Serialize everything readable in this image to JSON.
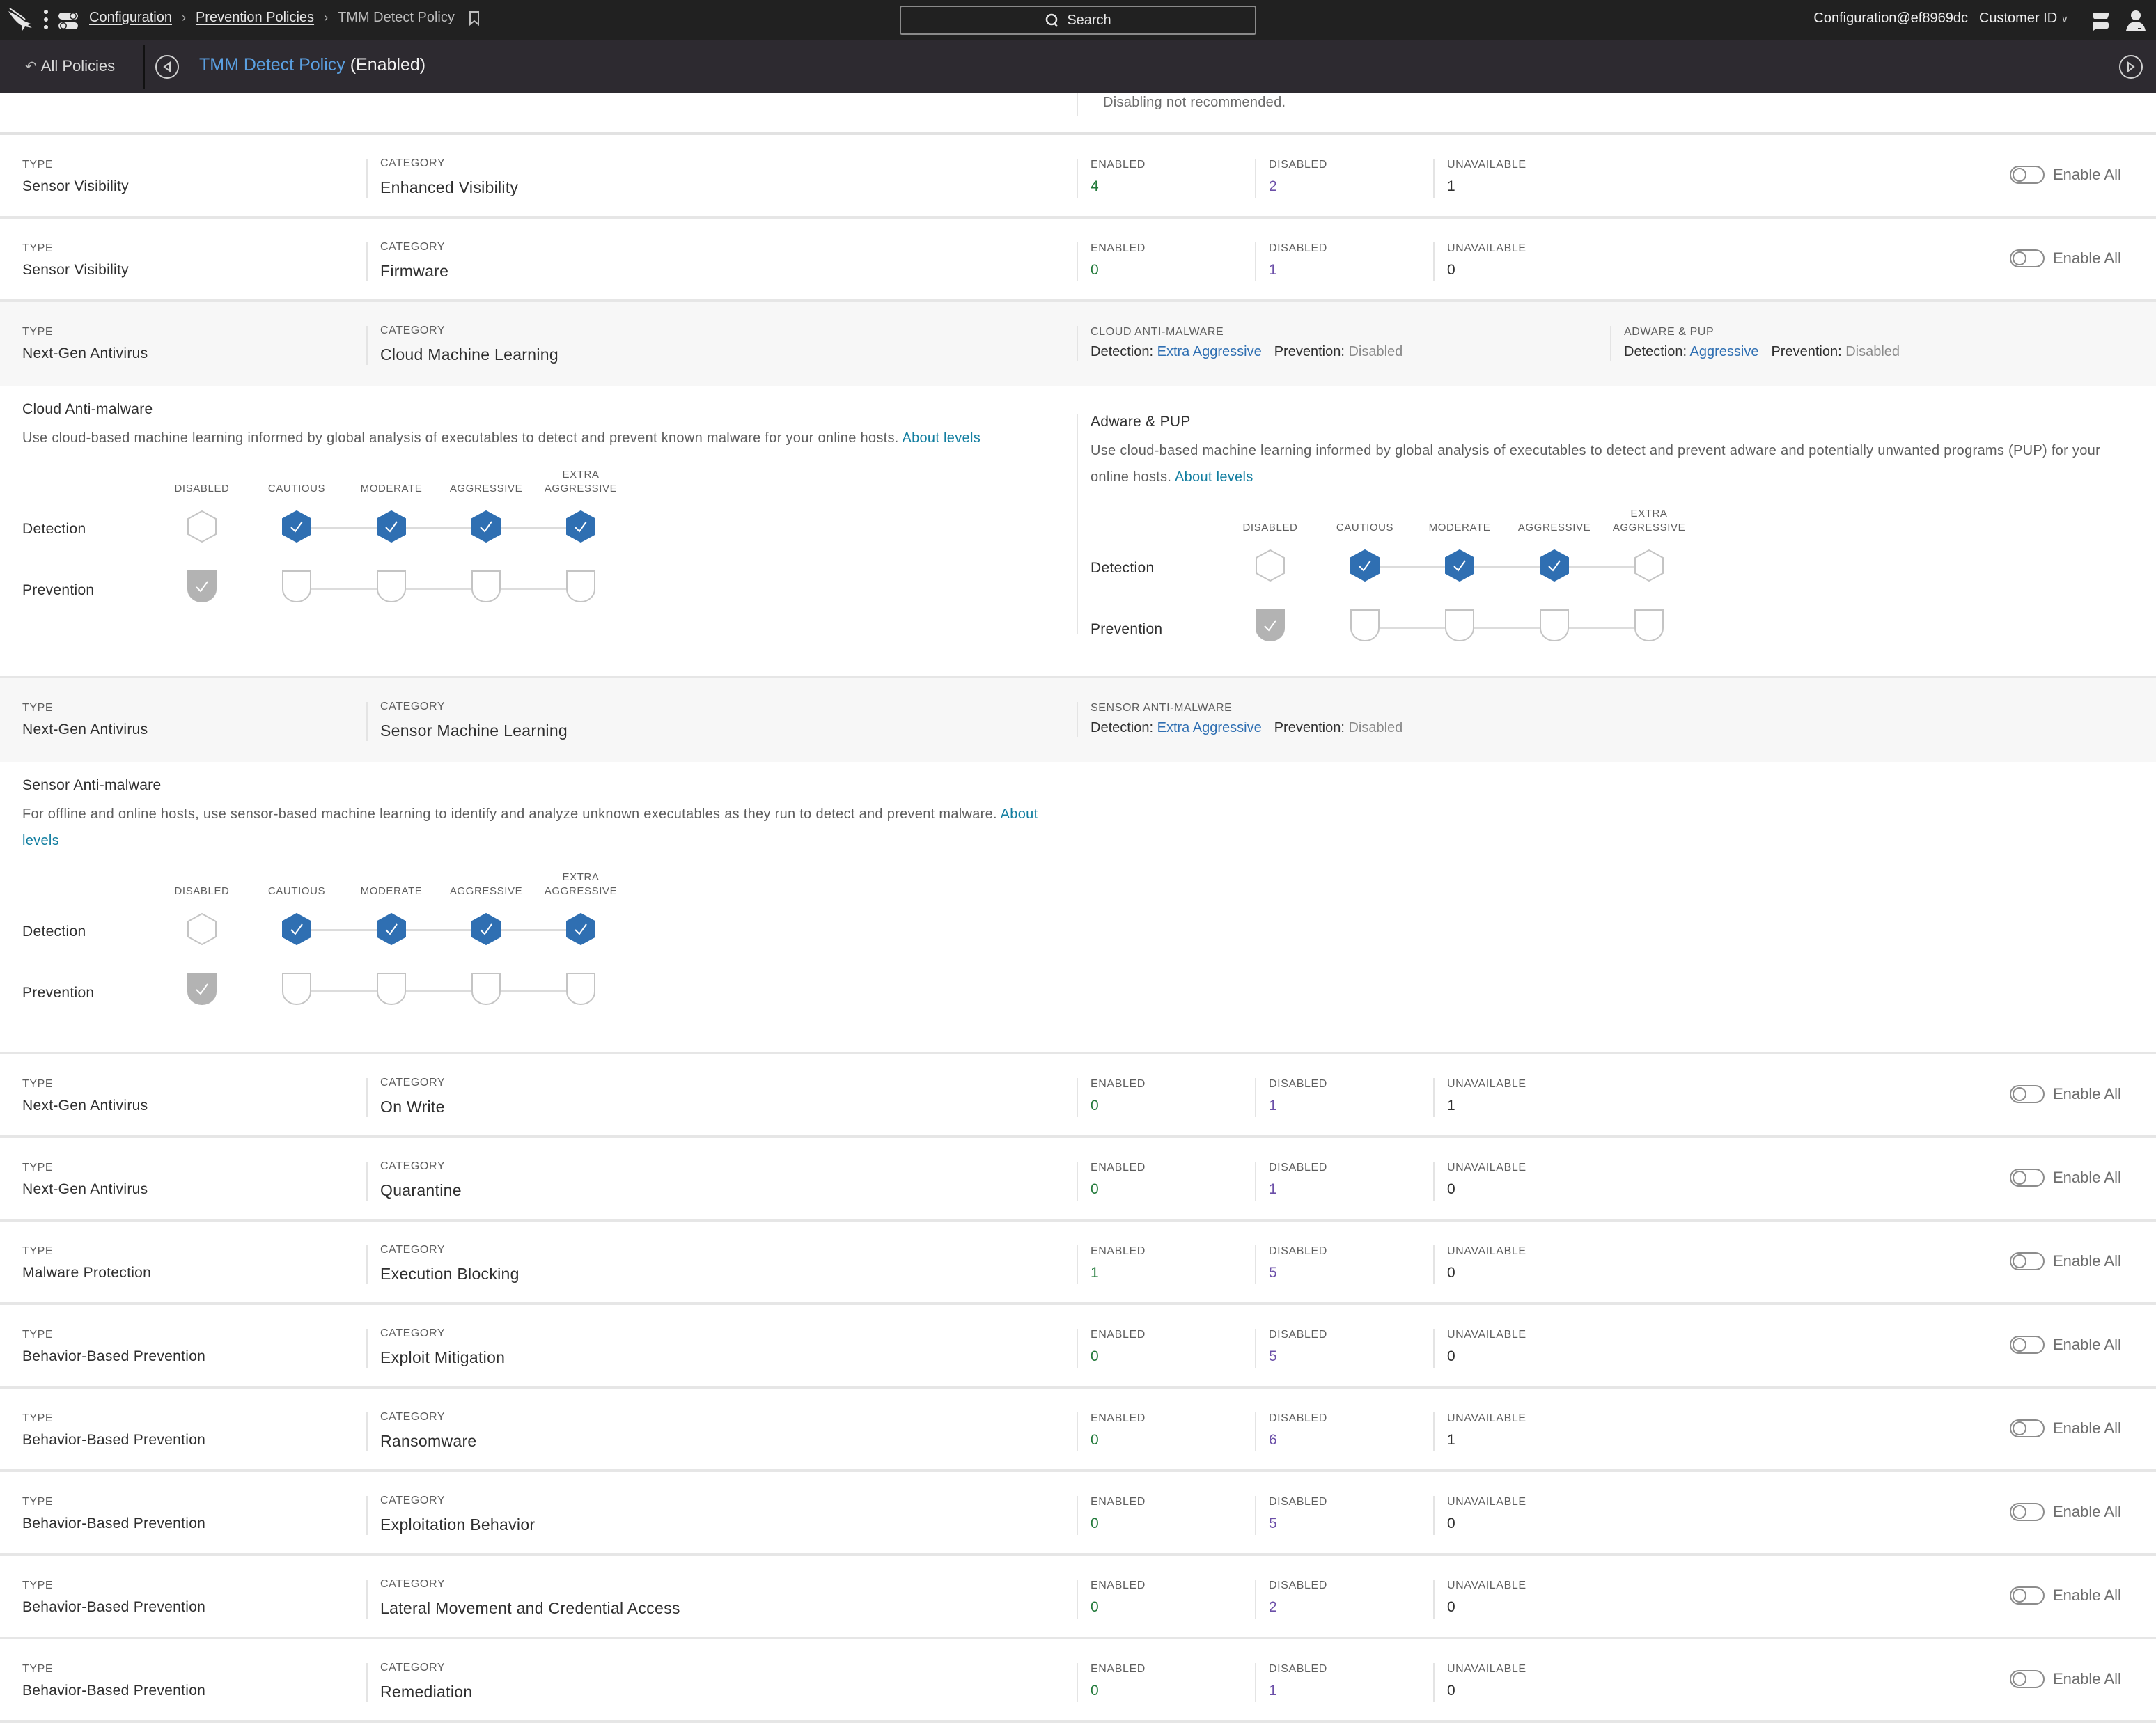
{
  "topbar": {
    "breadcrumbs": [
      {
        "label": "Configuration",
        "link": true
      },
      {
        "label": "Prevention Policies",
        "link": true
      },
      {
        "label": "TMM Detect Policy",
        "link": false
      }
    ],
    "search_label": "Search",
    "account": "Configuration@ef8969dc",
    "customer_id": "Customer ID"
  },
  "subbar": {
    "back_label": "All Policies",
    "policy_name": "TMM Detect Policy",
    "policy_state": "(Enabled)"
  },
  "note": "Disabling not recommended.",
  "labels": {
    "type": "TYPE",
    "category": "CATEGORY",
    "enabled": "ENABLED",
    "disabled": "DISABLED",
    "unavailable": "UNAVAILABLE",
    "enable_all": "Enable All",
    "detection_prefix": "Detection:",
    "prevention_prefix": "Prevention:",
    "detection_row": "Detection",
    "prevention_row": "Prevention",
    "about_levels": "About levels",
    "levels": [
      "DISABLED",
      "CAUTIOUS",
      "MODERATE",
      "AGGRESSIVE",
      "EXTRA AGGRESSIVE"
    ]
  },
  "colors": {
    "accent_blue": "#2f6fb2",
    "enabled_green": "#237a3b",
    "disabled_purple": "#6b4fa8",
    "link_teal": "#127ea0",
    "prevention_disabled_grey": "#b3b3b3"
  },
  "rows_top": [
    {
      "type": "Sensor Visibility",
      "category": "Enhanced Visibility",
      "enabled": "4",
      "disabled": "2",
      "unavailable": "1",
      "enable_all": false
    },
    {
      "type": "Sensor Visibility",
      "category": "Firmware",
      "enabled": "0",
      "disabled": "1",
      "unavailable": "0",
      "enable_all": false
    }
  ],
  "cloud_ml": {
    "type": "Next-Gen Antivirus",
    "category": "Cloud Machine Learning",
    "summaries": [
      {
        "label": "CLOUD ANTI-MALWARE",
        "detection": "Extra Aggressive",
        "prevention": "Disabled"
      },
      {
        "label": "ADWARE & PUP",
        "detection": "Aggressive",
        "prevention": "Disabled"
      }
    ],
    "panes": [
      {
        "title": "Cloud Anti-malware",
        "description": "Use cloud-based machine learning informed by global analysis of executables to detect and prevent known malware for your online hosts.",
        "detection_level": 4,
        "prevention_level": 0
      },
      {
        "title": "Adware & PUP",
        "description": "Use cloud-based machine learning informed by global analysis of executables to detect and prevent adware and potentially unwanted programs (PUP) for your online hosts.",
        "detection_level": 3,
        "prevention_level": 0
      }
    ]
  },
  "sensor_ml": {
    "type": "Next-Gen Antivirus",
    "category": "Sensor Machine Learning",
    "summaries": [
      {
        "label": "SENSOR ANTI-MALWARE",
        "detection": "Extra Aggressive",
        "prevention": "Disabled"
      }
    ],
    "panes": [
      {
        "title": "Sensor Anti-malware",
        "description": "For offline and online hosts, use sensor-based machine learning to identify and analyze unknown executables as they run to detect and prevent malware.",
        "detection_level": 4,
        "prevention_level": 0
      }
    ]
  },
  "rows_bottom": [
    {
      "type": "Next-Gen Antivirus",
      "category": "On Write",
      "enabled": "0",
      "disabled": "1",
      "unavailable": "1",
      "enable_all": false
    },
    {
      "type": "Next-Gen Antivirus",
      "category": "Quarantine",
      "enabled": "0",
      "disabled": "1",
      "unavailable": "0",
      "enable_all": false
    },
    {
      "type": "Malware Protection",
      "category": "Execution Blocking",
      "enabled": "1",
      "disabled": "5",
      "unavailable": "0",
      "enable_all": false
    },
    {
      "type": "Behavior-Based Prevention",
      "category": "Exploit Mitigation",
      "enabled": "0",
      "disabled": "5",
      "unavailable": "0",
      "enable_all": false
    },
    {
      "type": "Behavior-Based Prevention",
      "category": "Ransomware",
      "enabled": "0",
      "disabled": "6",
      "unavailable": "1",
      "enable_all": false
    },
    {
      "type": "Behavior-Based Prevention",
      "category": "Exploitation Behavior",
      "enabled": "0",
      "disabled": "5",
      "unavailable": "0",
      "enable_all": false
    },
    {
      "type": "Behavior-Based Prevention",
      "category": "Lateral Movement and Credential Access",
      "enabled": "0",
      "disabled": "2",
      "unavailable": "0",
      "enable_all": false
    },
    {
      "type": "Behavior-Based Prevention",
      "category": "Remediation",
      "enabled": "0",
      "disabled": "1",
      "unavailable": "0",
      "enable_all": false
    }
  ]
}
